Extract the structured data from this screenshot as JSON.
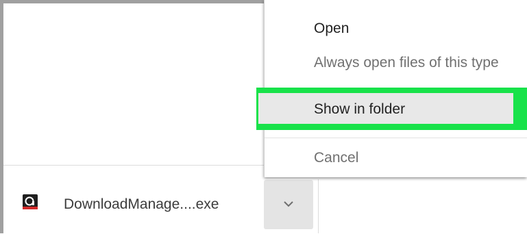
{
  "context_menu": {
    "items": [
      {
        "label": "Open"
      },
      {
        "label": "Always open files of this type"
      },
      {
        "label": "Show in folder"
      },
      {
        "label": "Cancel"
      }
    ],
    "highlight_color": "#18e24a"
  },
  "downloads_shelf": {
    "item": {
      "file_name": "DownloadManage....exe",
      "icon": "download-manager-app-icon",
      "menu_button_icon": "chevron-down-icon"
    }
  }
}
